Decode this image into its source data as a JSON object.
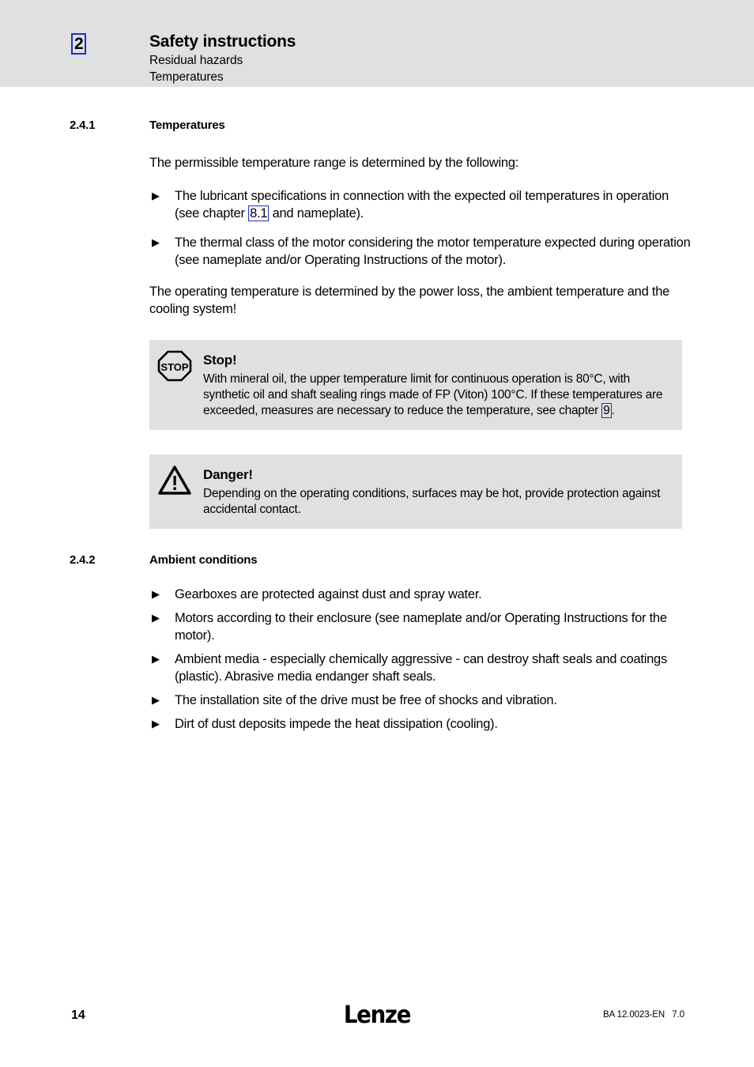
{
  "header": {
    "chapter_number": "2",
    "title": "Safety instructions",
    "subtitle_1": "Residual hazards",
    "subtitle_2": "Temperatures"
  },
  "sections": [
    {
      "number": "2.4.1",
      "title": "Temperatures",
      "intro": "The permissible temperature range is determined by the following:",
      "bullets": [
        {
          "text_before": "The lubricant specifications in connection with the expected oil temperatures in operation (see chapter ",
          "xref": "8.1",
          "text_after": " and nameplate)."
        },
        {
          "text_before": "The thermal class of the motor considering the motor temperature expected during operation (see nameplate and/or Operating Instructions of the motor).",
          "xref": "",
          "text_after": ""
        }
      ],
      "closing": "The operating temperature is determined by the power loss, the ambient temperature and the cooling system!"
    },
    {
      "number": "2.4.2",
      "title": "Ambient conditions",
      "bullets": [
        "Gearboxes are protected against dust and spray water.",
        "Motors according to their enclosure (see nameplate and/or Operating Instructions for the motor).",
        "Ambient media - especially chemically aggressive - can destroy shaft seals and coatings (plastic). Abrasive media endanger shaft seals.",
        "The installation site of the drive must be free of shocks and vibration.",
        "Dirt of dust deposits impede the heat dissipation (cooling).",
        ""
      ]
    }
  ],
  "notices": [
    {
      "icon": "stop-octagon-icon",
      "icon_label": "STOP",
      "title": "Stop!",
      "body_before": "With mineral oil, the upper temperature limit for continuous operation is 80°C, with synthetic oil and shaft sealing rings made of FP (Viton) 100°C. If these temperatures are exceeded, measures are necessary to reduce the temperature, see chapter ",
      "xref": "9",
      "body_after": "."
    },
    {
      "icon": "warning-triangle-icon",
      "title": "Danger!",
      "body_before": "Depending on the operating conditions, surfaces may be hot, provide protection against accidental contact.",
      "xref": "",
      "body_after": ""
    }
  ],
  "bullet_marker": "▶",
  "footer": {
    "page_number": "14",
    "logo": "Lenze",
    "document_id": "BA 12.0023-EN   7.0"
  },
  "colors": {
    "header_band": "#e0e0e0",
    "notice_box": "#e0e0e0",
    "xref_border": "#1a2fd0",
    "text": "#000000"
  }
}
